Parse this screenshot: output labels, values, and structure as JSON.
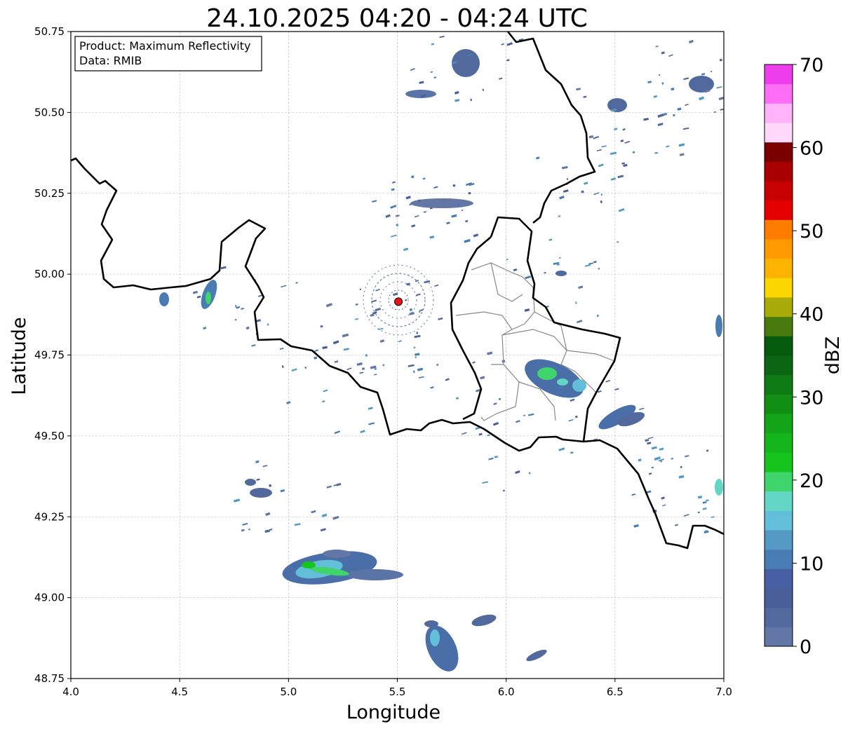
{
  "title": "24.10.2025 04:20 - 04:24 UTC",
  "info_box": {
    "product": "Product: Maximum Reflectivity",
    "data": "Data: RMIB"
  },
  "axes": {
    "xlabel": "Longitude",
    "ylabel": "Latitude",
    "xlim": [
      4.0,
      7.0
    ],
    "ylim": [
      48.75,
      50.75
    ],
    "xticks": [
      "4.0",
      "4.5",
      "5.0",
      "5.5",
      "6.0",
      "6.5",
      "7.0"
    ],
    "yticks": [
      "48.75",
      "49.00",
      "49.25",
      "49.50",
      "49.75",
      "50.00",
      "50.25",
      "50.50",
      "50.75"
    ],
    "grid": true
  },
  "colorbar": {
    "label": "dBZ",
    "range": [
      0,
      70
    ],
    "ticks": [
      "0",
      "10",
      "20",
      "30",
      "40",
      "50",
      "60",
      "70"
    ],
    "colors": [
      "#6277a6",
      "#52699e",
      "#4a5f9a",
      "#4760a3",
      "#4a7cb4",
      "#5499c4",
      "#62bed9",
      "#63d6c6",
      "#3fd46c",
      "#15c41d",
      "#14b41b",
      "#13a417",
      "#118f15",
      "#0d7a13",
      "#0a6612",
      "#065a0e",
      "#497a0d",
      "#a9ab0b",
      "#fcd600",
      "#fdb400",
      "#fe9a00",
      "#fe7c00",
      "#e50000",
      "#c70000",
      "#a80000",
      "#7a0000",
      "#ffd8fa",
      "#feb3fa",
      "#fd6ef6",
      "#ee3ded"
    ]
  },
  "radar_site": {
    "lon": 5.505,
    "lat": 49.915,
    "color": "#e8141b"
  },
  "colors": {
    "national_border": "#000000",
    "district_border": "#888888",
    "grid": "#bbbbbb"
  }
}
